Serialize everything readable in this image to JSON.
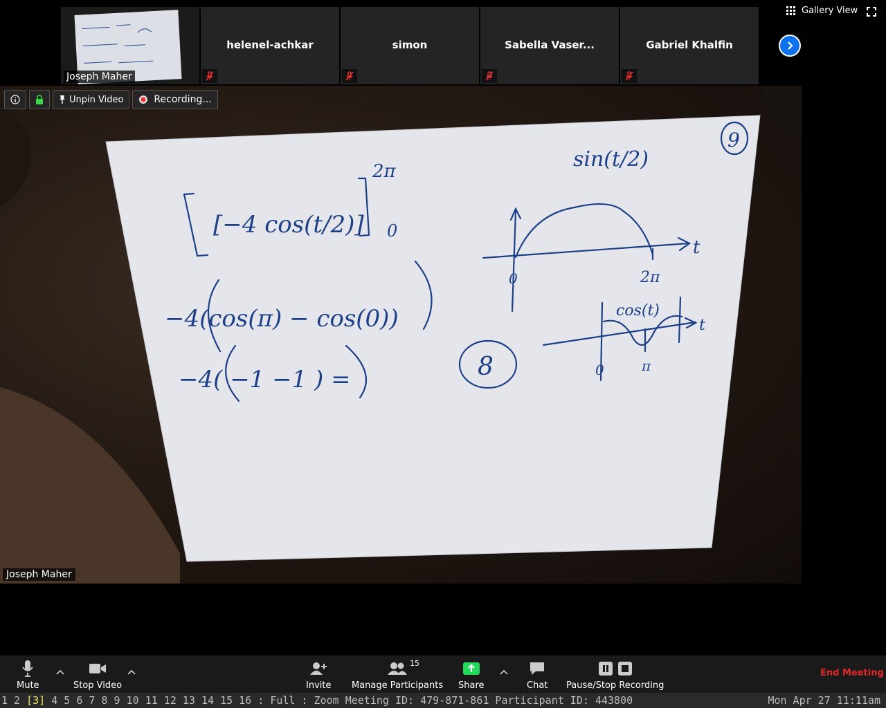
{
  "top_bar": {
    "self_tile_name": "Joseph Maher",
    "participants": [
      {
        "name": "helenel-achkar"
      },
      {
        "name": "simon"
      },
      {
        "name": "Sabella Vaser..."
      },
      {
        "name": "Gabriel Khalfin"
      }
    ],
    "gallery_view_label": "Gallery View"
  },
  "video_toolbar": {
    "unpin_label": "Unpin Video",
    "recording_label": "Recording..."
  },
  "main_video": {
    "speaker_name": "Joseph Maher",
    "whiteboard": {
      "page_number": "9",
      "line1_expr": "[−4 cos(t/2)]",
      "line1_upper": "2π",
      "line1_lower": "0",
      "line2_expr": "−4(cos(π) − cos(0))",
      "line3_expr": "−4( −1 −1 ) =",
      "answer": "8",
      "graph1_title": "sin(t/2)",
      "graph1_axis": "t",
      "graph1_origin": "0",
      "graph1_end": "2π",
      "graph2_title": "cos(t)",
      "graph2_axis": "t",
      "graph2_origin": "0",
      "graph2_end": "π"
    }
  },
  "bottom_bar": {
    "mute_label": "Mute",
    "stop_video_label": "Stop Video",
    "invite_label": "Invite",
    "manage_participants_label": "Manage Participants",
    "participant_count": "15",
    "share_label": "Share",
    "chat_label": "Chat",
    "record_label": "Pause/Stop Recording",
    "end_label": "End Meeting"
  },
  "status_line": {
    "pre": "1 2 ",
    "current": "[3]",
    "post": " 4 5 6 7 8 9 10 11 12 13 14 15 16 : Full : Zoom Meeting ID: 479-871-861 Participant ID: 443800",
    "clock": "Mon Apr 27 11:11am"
  },
  "colors": {
    "accent_blue": "#0e72ed",
    "share_green": "#23d959",
    "end_red": "#e02828",
    "ink": "#1c3f86",
    "paper": "#e6e8ee"
  }
}
